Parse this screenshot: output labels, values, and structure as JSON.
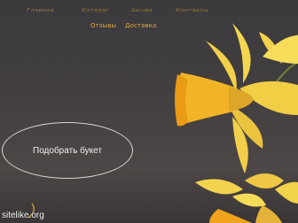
{
  "nav": {
    "row1": [
      "Главная",
      "Каталог",
      "Акции",
      "Контакты"
    ],
    "row2": [
      "Отзывы",
      "Доставка"
    ]
  },
  "cta": {
    "label": "Подобрать букет"
  },
  "watermark": {
    "text": "sitelike.org"
  },
  "colors": {
    "accent": "#d9a93c",
    "background": "#3c393b",
    "petal": "#f2d04a",
    "trumpet": "#f0a81f"
  },
  "icons": [
    "daffodil-image",
    "swirl-decoration-icon"
  ]
}
